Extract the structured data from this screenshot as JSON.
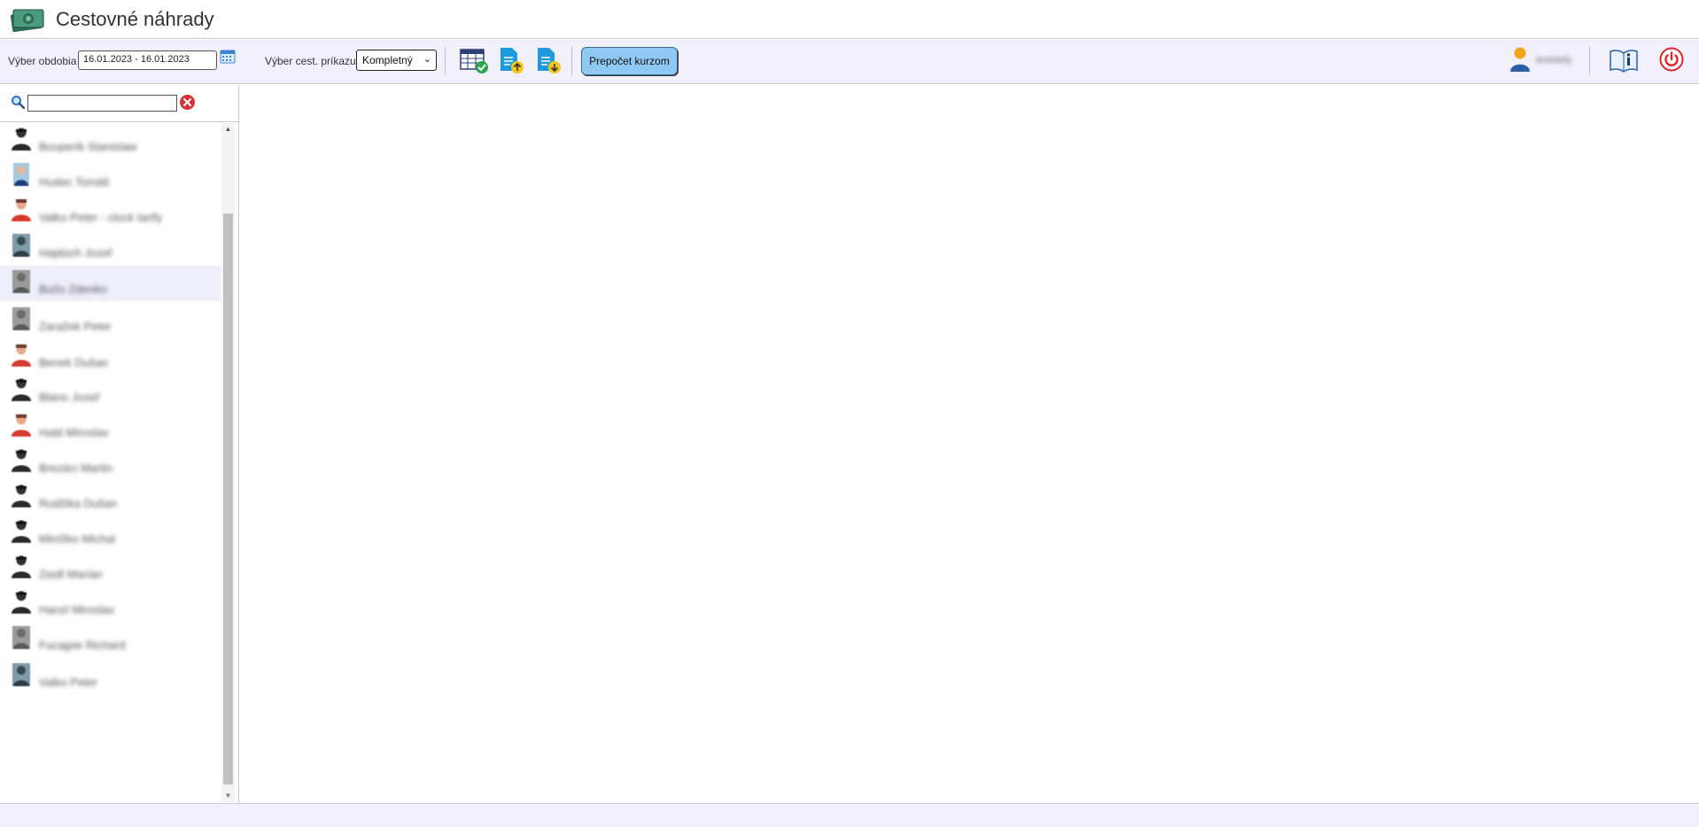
{
  "app": {
    "title": "Cestovné náhrady",
    "logo_icon": "money-bill-icon"
  },
  "toolbar": {
    "period_label": "Výber obdobia",
    "period_value": "16.01.2023 - 16.01.2023",
    "order_label": "Výber cest. príkazu",
    "order_select_value": "Kompletný",
    "recalc_button": "Prepočet kurzom",
    "user_name": "testdaily",
    "icons": [
      "calendar-icon",
      "table-check-icon",
      "document-upload-icon",
      "document-download-icon",
      "user-icon",
      "help-book-icon",
      "power-icon"
    ]
  },
  "sidebar": {
    "search_value": "",
    "people": [
      {
        "name": "Bouperik Stanislaw",
        "avatar": "dark"
      },
      {
        "name": "Hudec Tomáš",
        "avatar": "blue"
      },
      {
        "name": "Valko Peter - clock tarify",
        "avatar": "red"
      },
      {
        "name": "Hajdúch Jozef",
        "avatar": "photo"
      },
      {
        "name": "Bučo Zdenko",
        "avatar": "photo-gray"
      },
      {
        "name": "Zaražek Peter",
        "avatar": "photo-gray"
      },
      {
        "name": "Benek Dušan",
        "avatar": "red"
      },
      {
        "name": "Blano Jozef",
        "avatar": "dark"
      },
      {
        "name": "Hald Miroslav",
        "avatar": "red"
      },
      {
        "name": "Brezáci Martin",
        "avatar": "dark"
      },
      {
        "name": "Rudžika Dušan",
        "avatar": "dark"
      },
      {
        "name": "Minížko Michal",
        "avatar": "dark"
      },
      {
        "name": "Zeidl Marián",
        "avatar": "dark"
      },
      {
        "name": "Hanzl Miroslav",
        "avatar": "dark"
      },
      {
        "name": "Fucajpie Richard",
        "avatar": "photo-gray"
      },
      {
        "name": "Valko Peter",
        "avatar": "photo"
      }
    ],
    "selected_index": 4
  },
  "colors": {
    "toolbar_bg": "#f1f0fb",
    "button_bg": "#8fc8f2",
    "selected_row": "#efeefb",
    "border": "#c9c9d6"
  }
}
